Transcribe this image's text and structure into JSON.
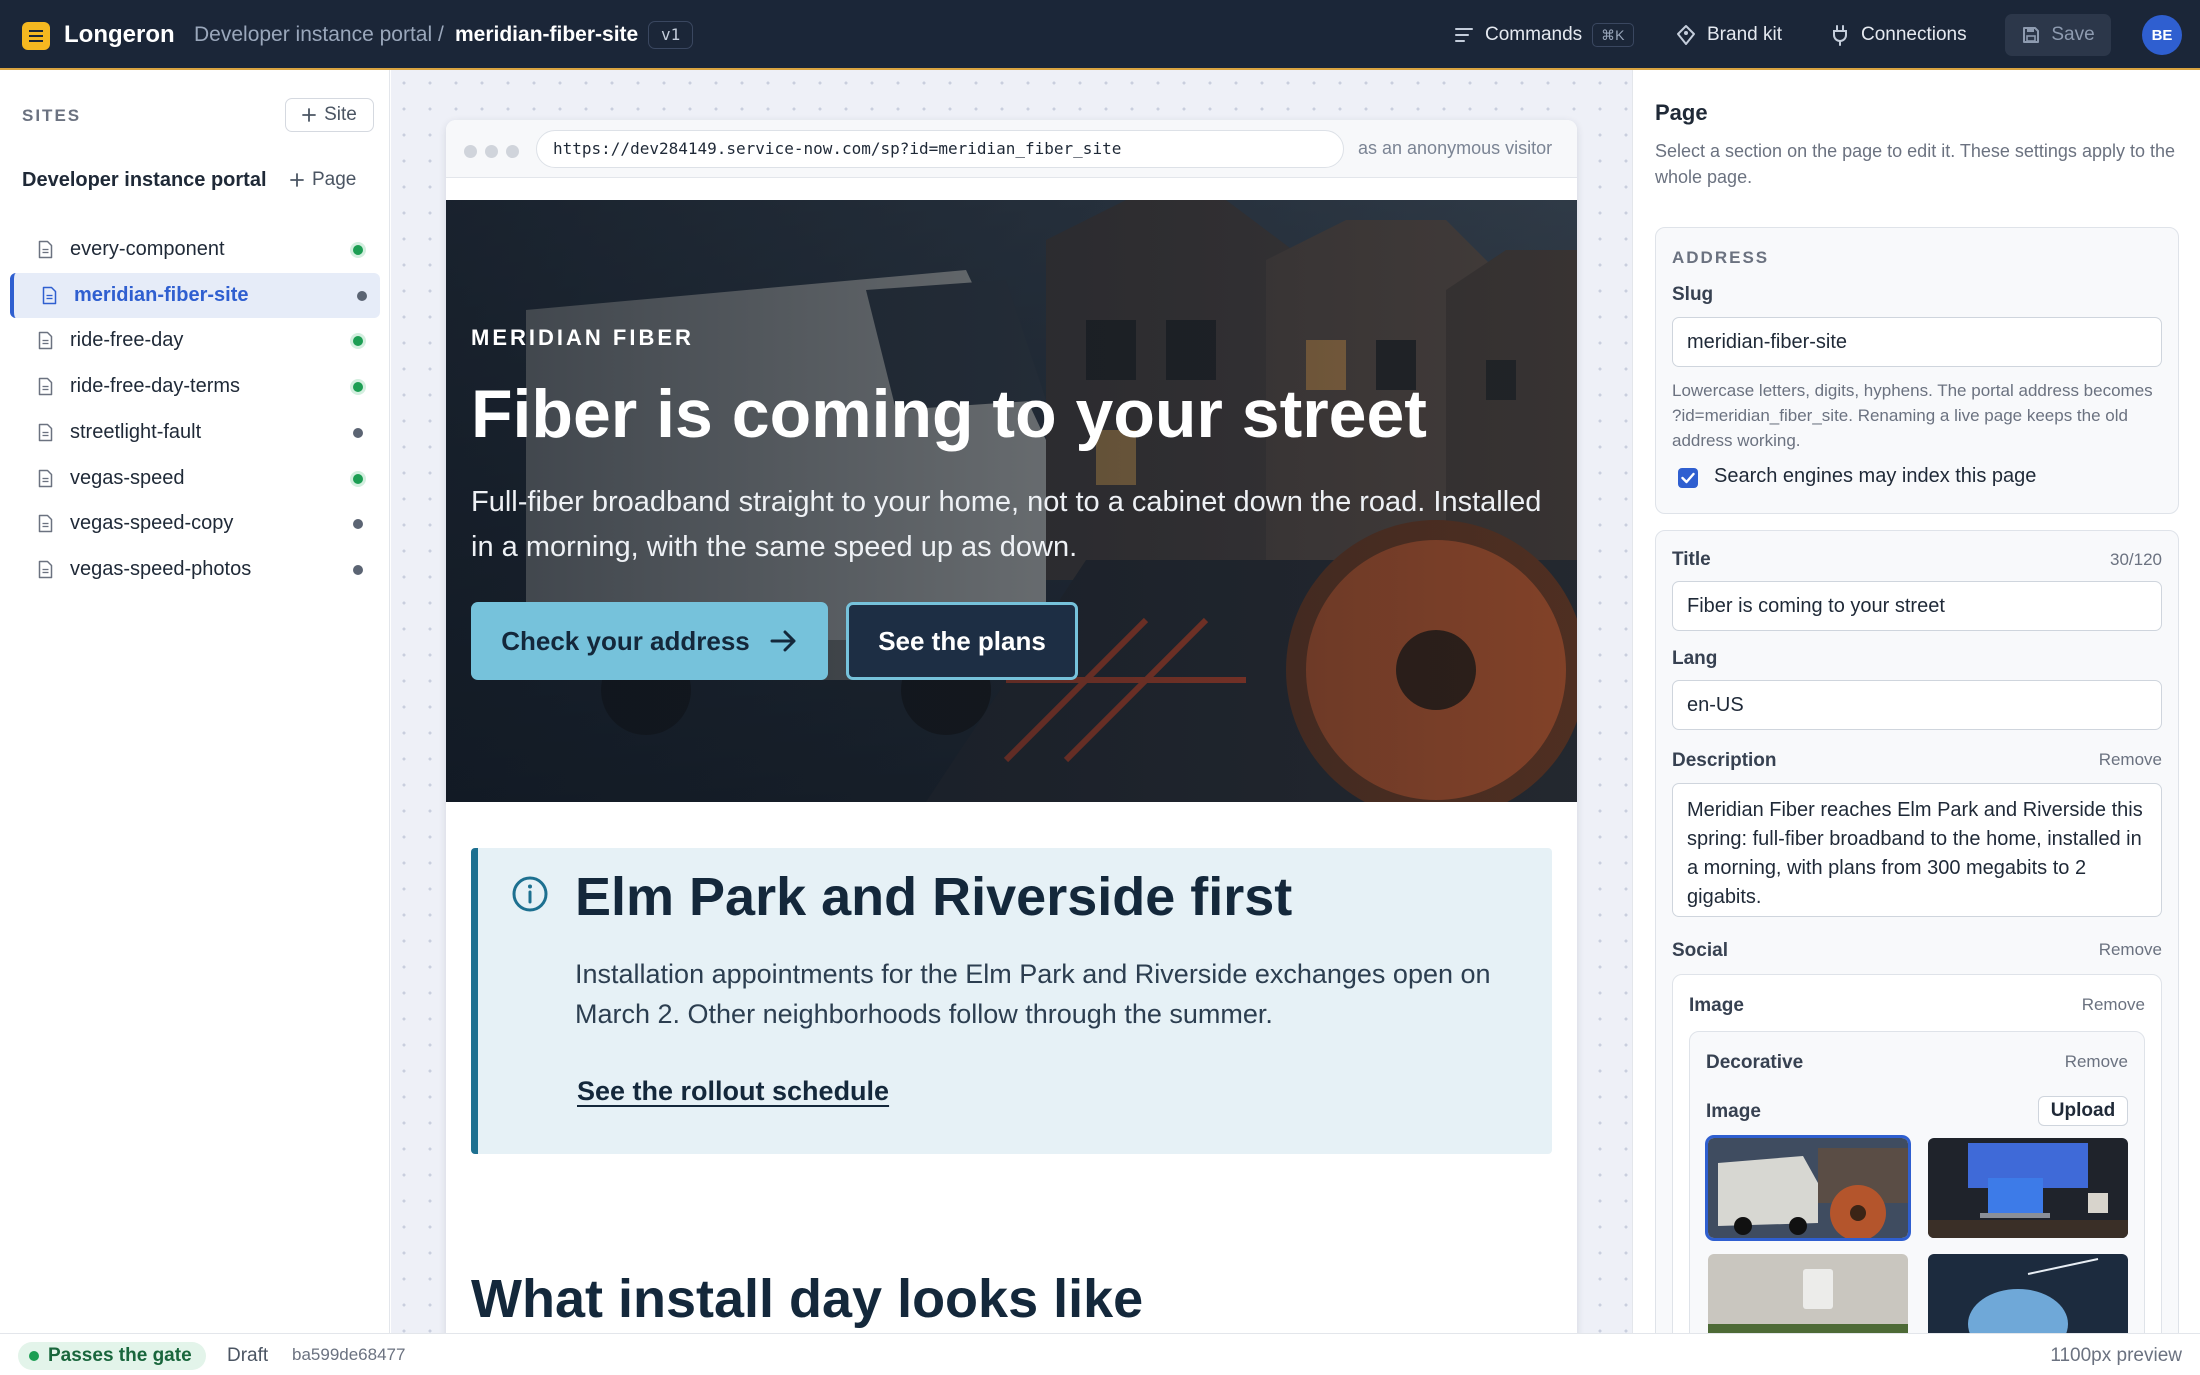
{
  "app": {
    "name": "Longeron"
  },
  "breadcrumb": {
    "root": "Developer instance portal",
    "separator": "/",
    "current": "meridian-fiber-site",
    "version": "v1"
  },
  "toolbar": {
    "commands_label": "Commands",
    "commands_shortcut": "⌘K",
    "brand_kit_label": "Brand kit",
    "connections_label": "Connections",
    "save_label": "Save",
    "avatar_initials": "BE"
  },
  "sidebar": {
    "sites_label": "SITES",
    "add_site_label": "Site",
    "group_title": "Developer instance portal",
    "add_page_label": "Page",
    "pages": [
      {
        "label": "every-component",
        "status": "live"
      },
      {
        "label": "meridian-fiber-site",
        "status": "draft",
        "active": true
      },
      {
        "label": "ride-free-day",
        "status": "live"
      },
      {
        "label": "ride-free-day-terms",
        "status": "live"
      },
      {
        "label": "streetlight-fault",
        "status": "draft"
      },
      {
        "label": "vegas-speed",
        "status": "live"
      },
      {
        "label": "vegas-speed-copy",
        "status": "draft"
      },
      {
        "label": "vegas-speed-photos",
        "status": "draft"
      }
    ]
  },
  "preview": {
    "url": "https://dev284149.service-now.com/sp?id=meridian_fiber_site",
    "visitor": "as an anonymous visitor",
    "hero": {
      "kicker": "MERIDIAN FIBER",
      "title": "Fiber is coming to your street",
      "body": "Full-fiber broadband straight to your home, not to a cabinet down the road. Installed in a morning, with the same speed up as down.",
      "primary_cta": "Check your address",
      "secondary_cta": "See the plans"
    },
    "notice": {
      "title": "Elm Park and Riverside first",
      "body": "Installation appointments for the Elm Park and Riverside exchanges open on March 2. Other neighborhoods follow through the summer.",
      "link": "See the rollout schedule"
    },
    "next_heading": "What install day looks like"
  },
  "inspector": {
    "title": "Page",
    "help": "Select a section on the page to edit it. These settings apply to the whole page.",
    "address": {
      "section_label": "ADDRESS",
      "slug_label": "Slug",
      "slug_value": "meridian-fiber-site",
      "slug_hint": "Lowercase letters, digits, hyphens. The portal address becomes ?id=meridian_fiber_site. Renaming a live page keeps the old address working.",
      "index_label": "Search engines may index this page",
      "index_checked": true
    },
    "meta": {
      "title_label": "Title",
      "title_counter": "30/120",
      "title_value": "Fiber is coming to your street",
      "lang_label": "Lang",
      "lang_value": "en-US",
      "description_label": "Description",
      "description_remove": "Remove",
      "description_value": "Meridian Fiber reaches Elm Park and Riverside this spring: full-fiber broadband to the home, installed in a morning, with plans from 300 megabits to 2 gigabits.",
      "social_label": "Social",
      "social_remove": "Remove",
      "image_label": "Image",
      "image_remove": "Remove",
      "decorative_label": "Decorative",
      "decorative_remove": "Remove",
      "picker_label": "Image",
      "upload_label": "Upload"
    }
  },
  "statusbar": {
    "gate": "Passes the gate",
    "state": "Draft",
    "hash": "ba599de68477",
    "preview_width": "1100px preview"
  },
  "colors": {
    "topbar": "#1b2638",
    "accent": "#2f5fd0",
    "live": "#1c9e53",
    "cta": "#76c2db",
    "notice_bg": "#e6f1f6",
    "notice_border": "#1d7090"
  }
}
